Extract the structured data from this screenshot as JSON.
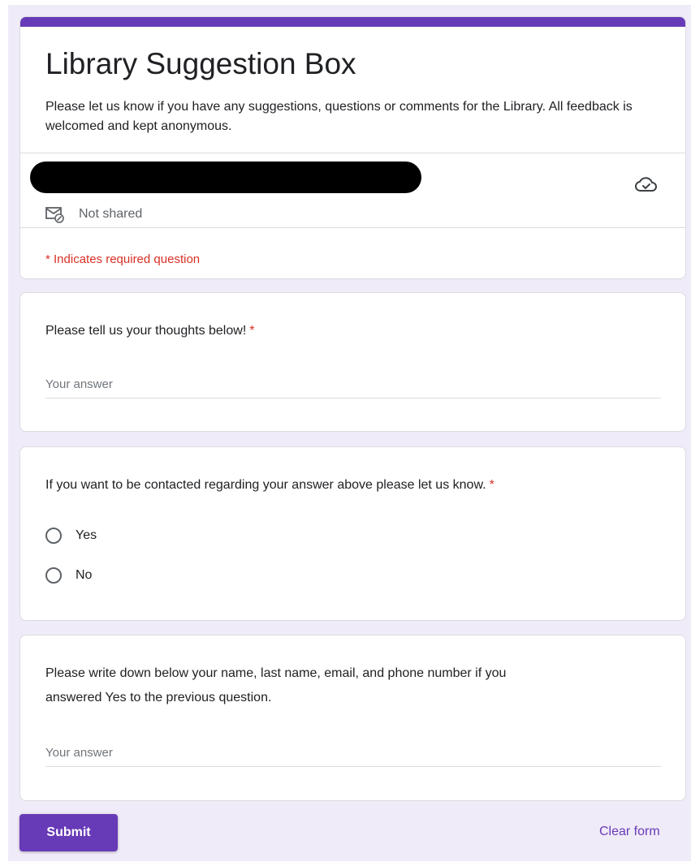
{
  "colors": {
    "accent": "#673ab7",
    "required": "#d93025",
    "page_background": "#f0ebf8"
  },
  "header": {
    "title": "Library Suggestion Box",
    "description": "Please let us know if you have any suggestions, questions or comments for the Library. All feedback is welcomed and kept anonymous.",
    "account": {
      "redacted": true,
      "cloud_icon": "cloud-check-icon",
      "mail_icon": "mail-not-shared-icon",
      "not_shared_label": "Not shared"
    },
    "required_note": "* Indicates required question"
  },
  "questions": [
    {
      "title": "Please tell us your thoughts below!",
      "required_marker": "*",
      "type": "short-answer",
      "placeholder": "Your answer",
      "value": ""
    },
    {
      "title": "If you want to be contacted regarding your answer above please let us know.",
      "required_marker": "*",
      "type": "multiple-choice",
      "options": [
        "Yes",
        "No"
      ],
      "selected": null
    },
    {
      "title_line1": "Please write down below your name, last name, email, and phone number if you",
      "title_line2": "answered Yes to the previous question.",
      "type": "short-answer",
      "placeholder": "Your answer",
      "value": ""
    }
  ],
  "footer": {
    "submit_label": "Submit",
    "clear_label": "Clear form"
  }
}
